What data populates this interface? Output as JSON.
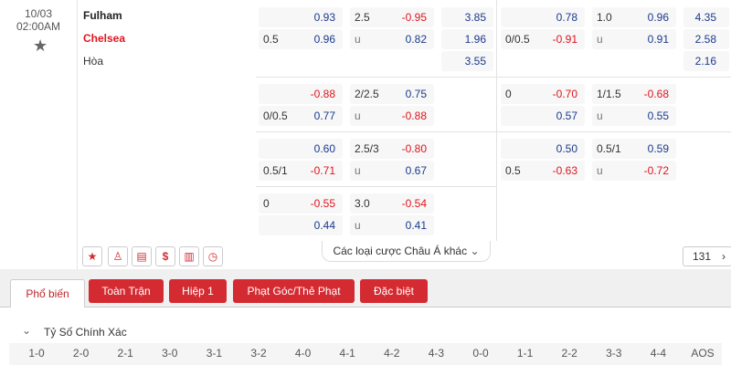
{
  "match": {
    "date": "10/03",
    "time": "02:00AM",
    "home": "Fulham",
    "away": "Chelsea",
    "draw": "Hòa"
  },
  "odds": {
    "ft_hcap": [
      {
        "line_top": "",
        "top": "0.93",
        "line_bot": "0.5",
        "bot": "0.96"
      },
      {
        "line_top": "",
        "top": "-0.88",
        "line_bot": "0/0.5",
        "bot": "0.77"
      },
      {
        "line_top": "",
        "top": "0.60",
        "line_bot": "0.5/1",
        "bot": "-0.71"
      },
      {
        "line_top": "0",
        "top": "-0.55",
        "line_bot": "",
        "bot": "0.44"
      }
    ],
    "ft_ou": [
      {
        "line": "2.5",
        "over": "-0.95",
        "u": "u",
        "under": "0.82"
      },
      {
        "line": "2/2.5",
        "over": "0.75",
        "u": "u",
        "under": "-0.88"
      },
      {
        "line": "2.5/3",
        "over": "-0.80",
        "u": "u",
        "under": "0.67"
      },
      {
        "line": "3.0",
        "over": "-0.54",
        "u": "u",
        "under": "0.41"
      }
    ],
    "ft_1x2": [
      "3.85",
      "1.96",
      "3.55"
    ],
    "h1_hcap": [
      {
        "line_top": "",
        "top": "0.78",
        "line_bot": "0/0.5",
        "bot": "-0.91"
      },
      {
        "line_top": "0",
        "top": "-0.70",
        "line_bot": "",
        "bot": "0.57"
      },
      {
        "line_top": "",
        "top": "0.50",
        "line_bot": "0.5",
        "bot": "-0.63"
      }
    ],
    "h1_ou": [
      {
        "line": "1.0",
        "over": "0.96",
        "u": "u",
        "under": "0.91"
      },
      {
        "line": "1/1.5",
        "over": "-0.68",
        "u": "u",
        "under": "0.55"
      },
      {
        "line": "0.5/1",
        "over": "0.59",
        "u": "u",
        "under": "-0.72"
      }
    ],
    "h1_1x2": [
      "4.35",
      "2.58",
      "2.16"
    ]
  },
  "more_bets": "Các loại cược Châu Á khác",
  "more_count": "131",
  "toolbar_icons": [
    "star-icon",
    "jersey-icon",
    "stadium-icon",
    "dollar-icon",
    "stats-icon",
    "clock-icon"
  ],
  "tabs": {
    "active": "Phổ biến",
    "items": [
      "Toàn Trận",
      "Hiệp 1",
      "Phạt Góc/Thẻ Phạt",
      "Đặc biệt"
    ]
  },
  "section": {
    "title": "Tỷ Số Chính Xác",
    "scores": [
      "1-0",
      "2-0",
      "2-1",
      "3-0",
      "3-1",
      "3-2",
      "4-0",
      "4-1",
      "4-2",
      "4-3",
      "0-0",
      "1-1",
      "2-2",
      "3-3",
      "4-4",
      "AOS"
    ]
  },
  "colors": {
    "accent": "#d42b32",
    "positive": "#1a3a8c",
    "negative": "#e0141e"
  }
}
